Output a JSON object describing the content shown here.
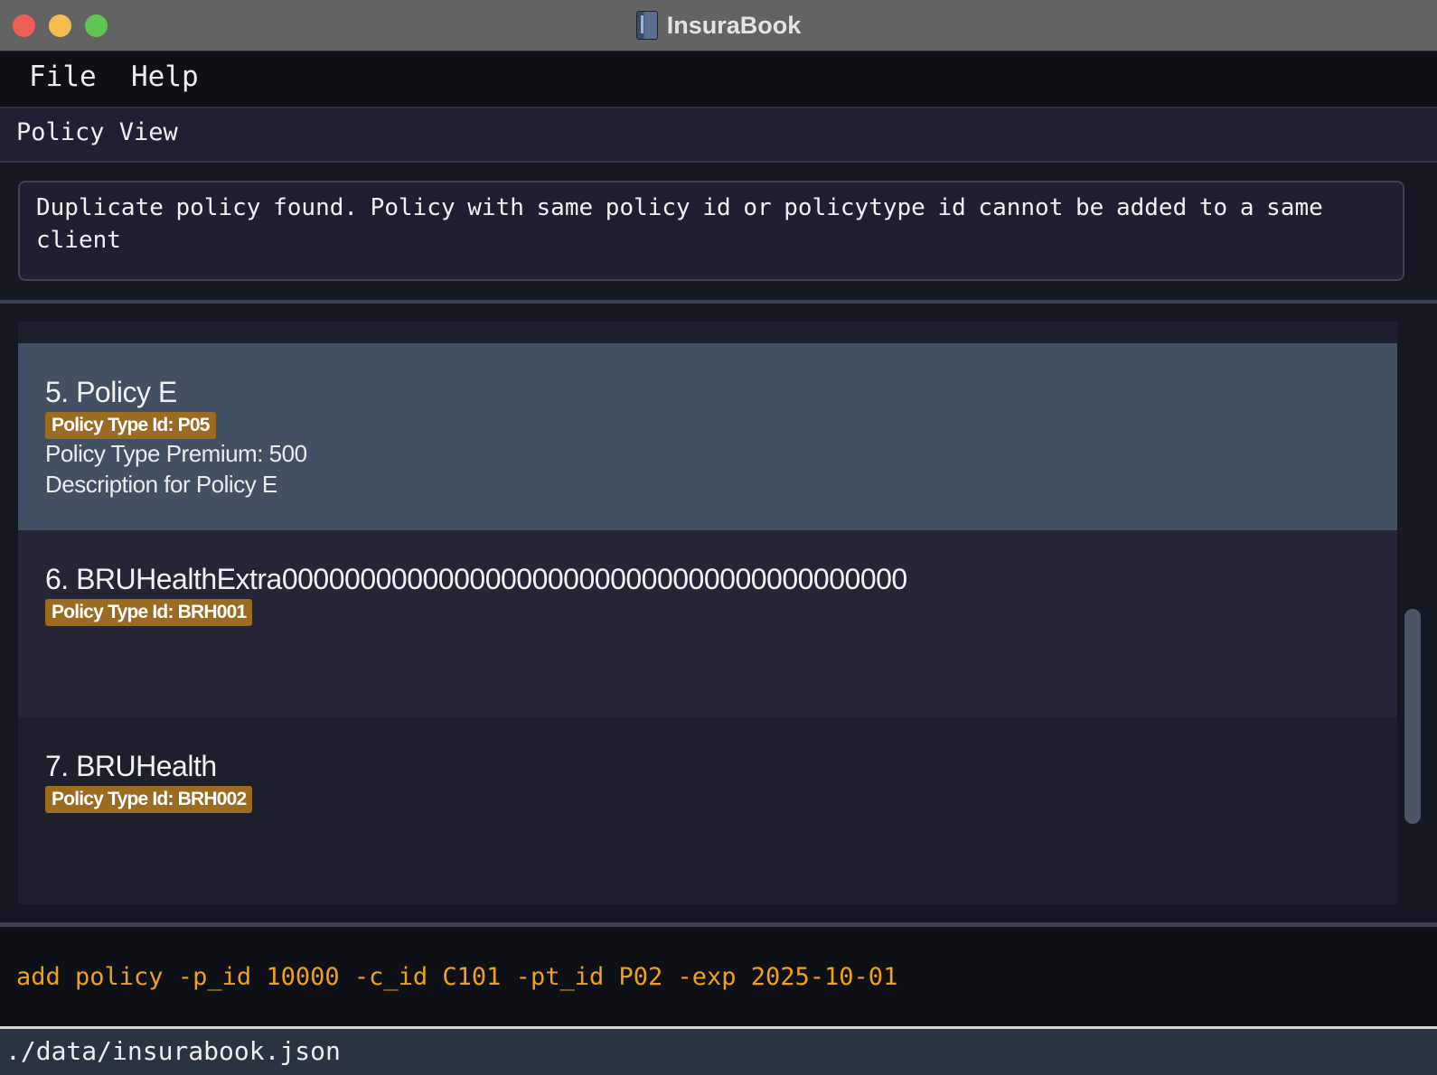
{
  "window": {
    "title": "InsuraBook",
    "icon": "notebook-icon"
  },
  "menu": {
    "items": [
      "File",
      "Help"
    ]
  },
  "view": {
    "label": "Policy View"
  },
  "result": {
    "message": "Duplicate policy found. Policy with same policy id or policytype id cannot be added to a same client"
  },
  "policies": [
    {
      "name": "5. Policy E",
      "badge": "Policy Type Id: P05",
      "premium": "Policy Type Premium: 500",
      "description": "Description for Policy E",
      "selected": true
    },
    {
      "name": "6. BRUHealthExtra0000000000000000000000000000000000000000",
      "badge": "Policy Type Id: BRH001"
    },
    {
      "name": "7. BRUHealth",
      "badge": "Policy Type Id: BRH002"
    }
  ],
  "command": {
    "value": "add policy -p_id 10000 -c_id C101 -pt_id P02 -exp 2025-10-01"
  },
  "status": {
    "file_path": "./data/insurabook.json"
  },
  "colors": {
    "badge": "#9b6b22",
    "command_text": "#f0a01a",
    "selected_cell": "#434f62"
  }
}
